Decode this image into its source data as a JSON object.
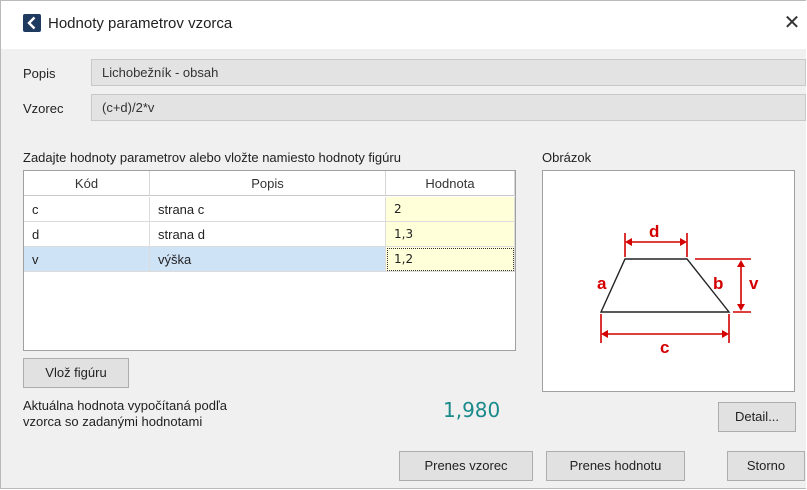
{
  "window": {
    "title": "Hodnoty parametrov vzorca",
    "close_glyph": "✕"
  },
  "form": {
    "description_label": "Popis",
    "description_value": "Lichobežník - obsah",
    "formula_label": "Vzorec",
    "formula_value": "(c+d)/2*v"
  },
  "grid": {
    "instruction": "Zadajte hodnoty parametrov alebo vložte namiesto hodnoty figúru",
    "columns": [
      "Kód",
      "Popis",
      "Hodnota"
    ],
    "rows": [
      {
        "code": "c",
        "desc": "strana c",
        "value": "2"
      },
      {
        "code": "d",
        "desc": "strana d",
        "value": "1,3"
      },
      {
        "code": "v",
        "desc": "výška",
        "value": "1,2"
      }
    ],
    "selected_row": 2
  },
  "insert_figure_button": "Vlož figúru",
  "result": {
    "caption_line1": "Aktuálna hodnota vypočítaná podľa",
    "caption_line2": "vzorca so zadanými hodnotami",
    "value": "1,980"
  },
  "image_panel": {
    "label": "Obrázok",
    "labels": {
      "a": "a",
      "b": "b",
      "c": "c",
      "d": "d",
      "v": "v"
    },
    "accent_color": "#d40000"
  },
  "buttons": {
    "detail": "Detail...",
    "transfer_formula": "Prenes vzorec",
    "transfer_value": "Prenes hodnotu",
    "cancel": "Storno"
  }
}
